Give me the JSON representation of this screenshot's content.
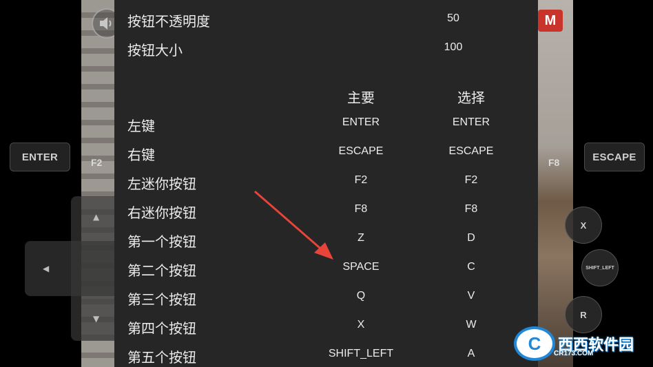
{
  "settings": {
    "opacity_label": "按钮不透明度",
    "opacity_value": "50",
    "size_label": "按钮大小",
    "size_value": "100"
  },
  "headers": {
    "main": "主要",
    "alt": "选择"
  },
  "rows": [
    {
      "label": "左键",
      "main": "ENTER",
      "alt": "ENTER"
    },
    {
      "label": "右键",
      "main": "ESCAPE",
      "alt": "ESCAPE"
    },
    {
      "label": "左迷你按钮",
      "main": "F2",
      "alt": "F2"
    },
    {
      "label": "右迷你按钮",
      "main": "F8",
      "alt": "F8"
    },
    {
      "label": "第一个按钮",
      "main": "Z",
      "alt": "D"
    },
    {
      "label": "第二个按钮",
      "main": "SPACE",
      "alt": "C"
    },
    {
      "label": "第三个按钮",
      "main": "Q",
      "alt": "V"
    },
    {
      "label": "第四个按钮",
      "main": "X",
      "alt": "W"
    },
    {
      "label": "第五个按钮",
      "main": "SHIFT_LEFT",
      "alt": "A"
    }
  ],
  "overlay": {
    "enter": "ENTER",
    "escape": "ESCAPE",
    "f2": "F2",
    "f8": "F8",
    "x": "X",
    "shift_left": "SHIFT_LEFT",
    "r": "R",
    "badge": "M"
  },
  "watermark": {
    "brand": "西西软件园",
    "site": "CR173.COM"
  },
  "colors": {
    "dialog_bg": "#262626",
    "arrow": "#e8443a",
    "text": "#ececec"
  },
  "icons": [
    "speaker-icon",
    "arrow-up-icon",
    "arrow-down-icon",
    "arrow-left-icon"
  ]
}
